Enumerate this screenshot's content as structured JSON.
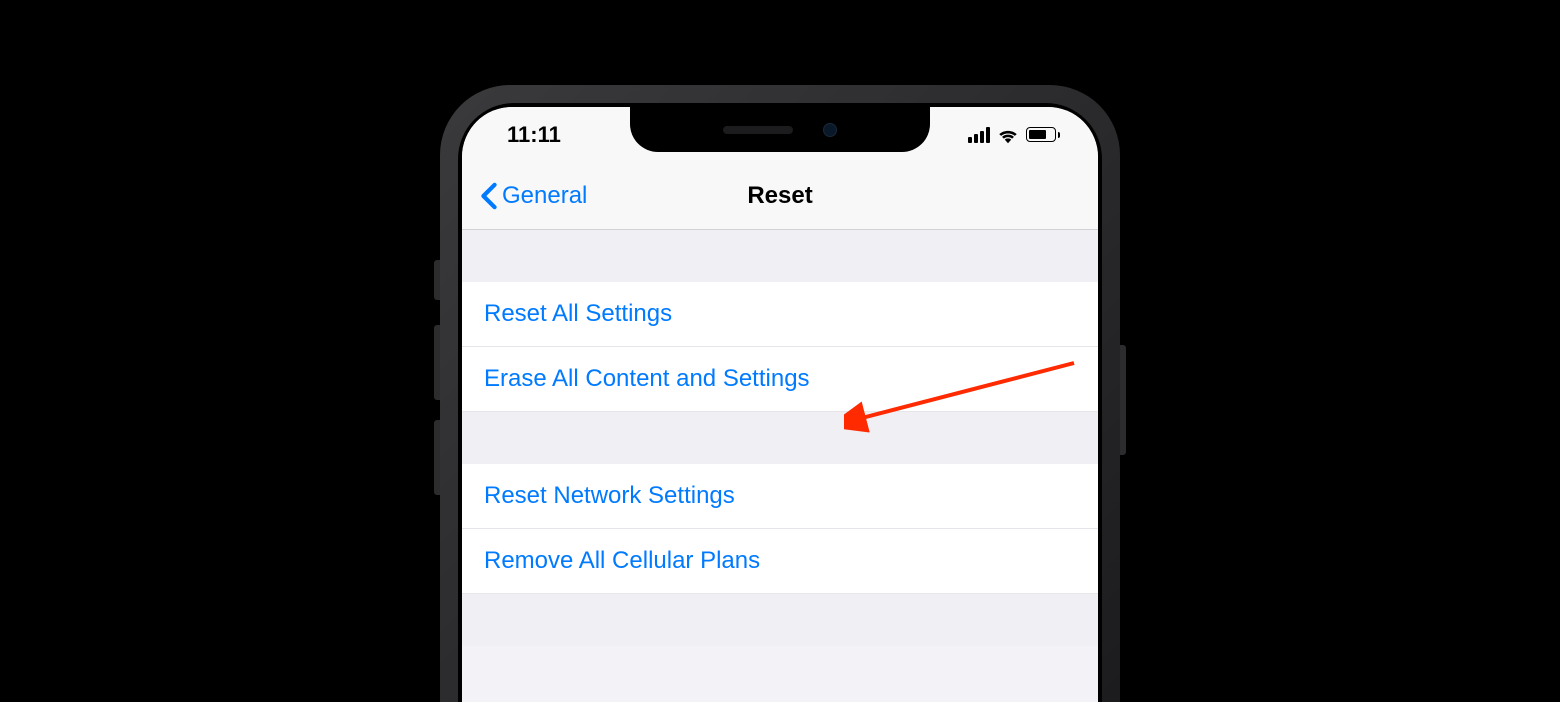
{
  "statusBar": {
    "time": "11:11"
  },
  "navBar": {
    "backLabel": "General",
    "title": "Reset"
  },
  "sections": [
    {
      "items": [
        {
          "label": "Reset All Settings"
        },
        {
          "label": "Erase All Content and Settings"
        }
      ]
    },
    {
      "items": [
        {
          "label": "Reset Network Settings"
        },
        {
          "label": "Remove All Cellular Plans"
        }
      ]
    }
  ]
}
